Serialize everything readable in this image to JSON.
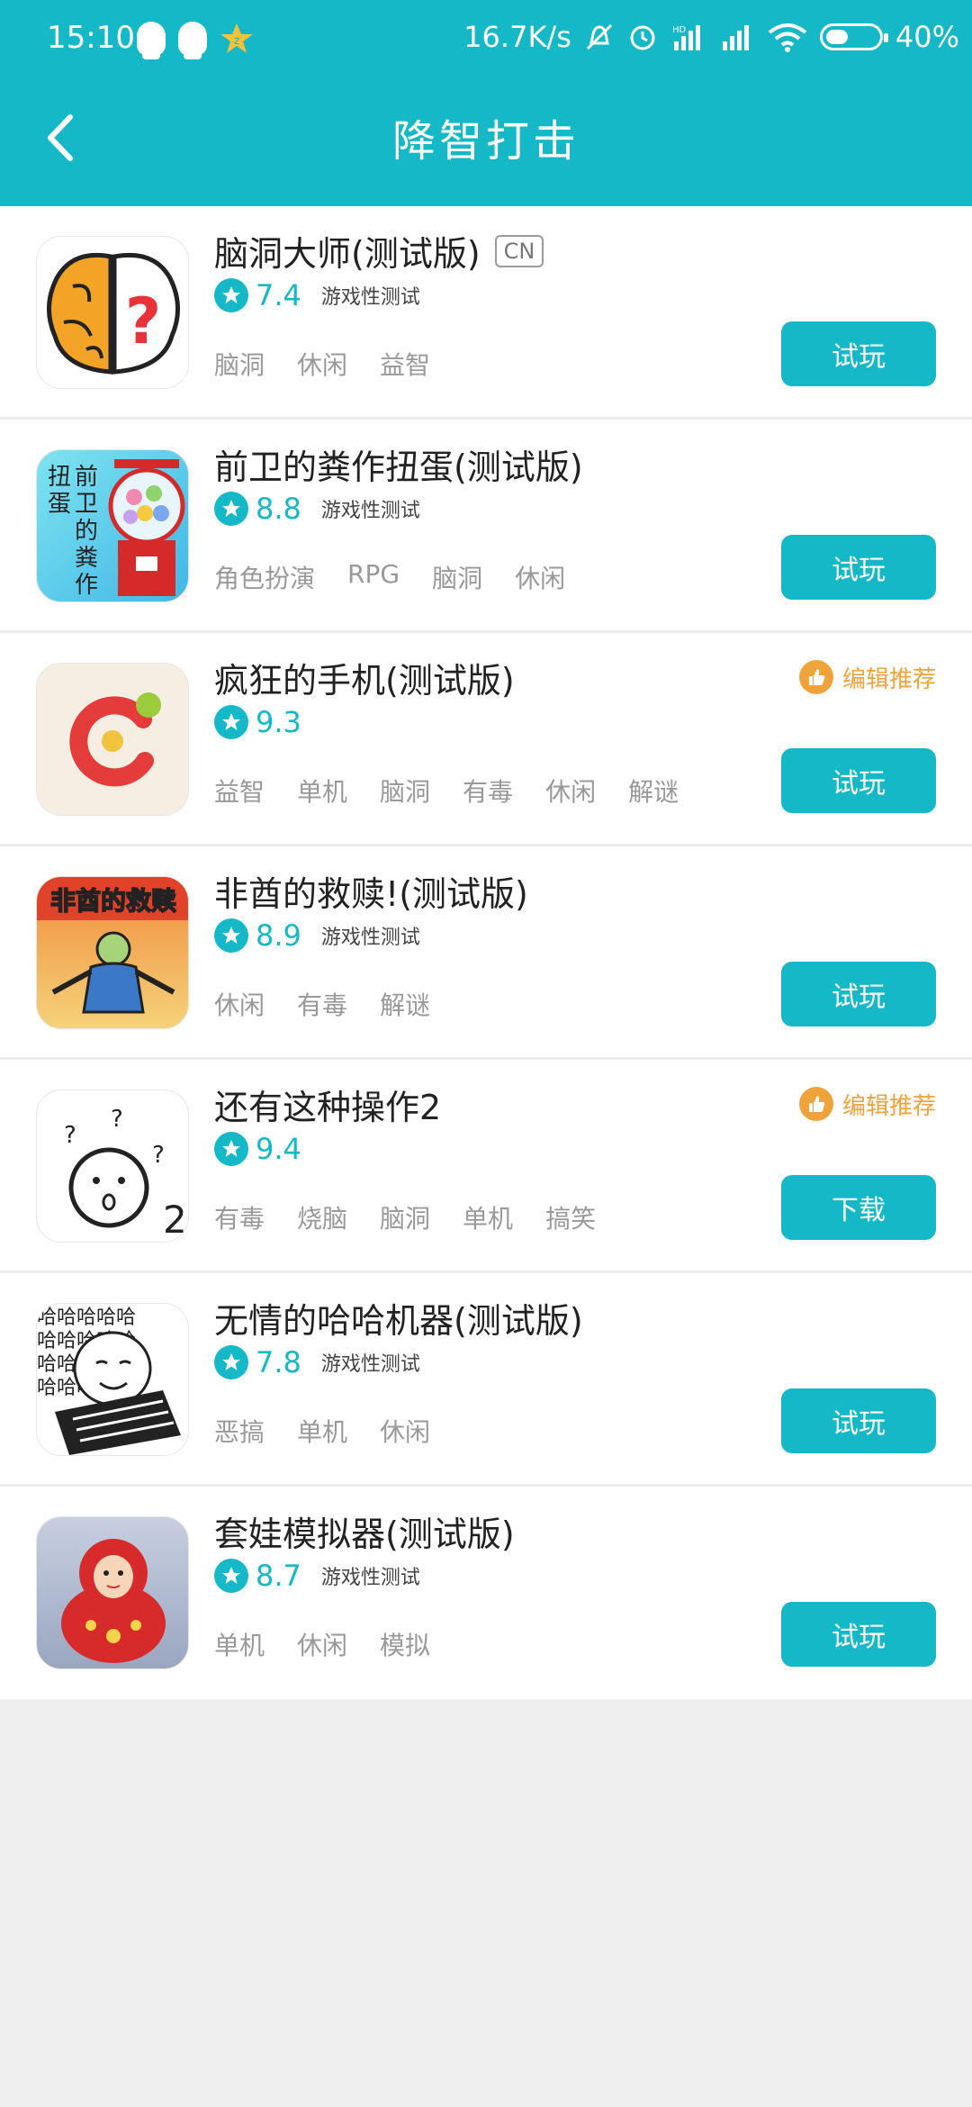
{
  "status_bar": {
    "time": "15:10",
    "network_speed": "16.7K/s",
    "battery": "40%",
    "icons": [
      "qq-icon",
      "qq-icon",
      "star-badge-icon",
      "mute-icon",
      "alarm-icon",
      "hd-signal-icon",
      "signal-icon",
      "wifi-icon",
      "battery-icon"
    ]
  },
  "header": {
    "title": "降智打击",
    "back_icon": "chevron-left-icon"
  },
  "colors": {
    "brand": "#15b8c7",
    "recommend": "#f0a33a",
    "tag_text": "#999999"
  },
  "games": [
    {
      "name": "脑洞大师(测试版)",
      "badge": "CN",
      "score": "7.4",
      "status": "游戏性测试",
      "tags": [
        "脑洞",
        "休闲",
        "益智"
      ],
      "button": "试玩",
      "recommend": "",
      "icon": "brain-question-icon"
    },
    {
      "name": "前卫的粪作扭蛋(测试版)",
      "badge": "",
      "score": "8.8",
      "status": "游戏性测试",
      "tags": [
        "角色扮演",
        "RPG",
        "脑洞",
        "休闲"
      ],
      "button": "试玩",
      "recommend": "",
      "icon": "gashapon-machine-icon",
      "icon_text_a": "前卫的粪作",
      "icon_text_b": "扭蛋"
    },
    {
      "name": "疯狂的手机(测试版)",
      "badge": "",
      "score": "9.3",
      "status": "",
      "tags": [
        "益智",
        "单机",
        "脑洞",
        "有毒",
        "休闲",
        "解谜"
      ],
      "button": "试玩",
      "recommend": "编辑推荐",
      "icon": "crazy-phone-logo-icon"
    },
    {
      "name": "非酋的救赎!(测试版)",
      "badge": "",
      "score": "8.9",
      "status": "游戏性测试",
      "tags": [
        "休闲",
        "有毒",
        "解谜"
      ],
      "button": "试玩",
      "recommend": "",
      "icon": "redemption-comic-icon",
      "icon_text": "非酋的救赎"
    },
    {
      "name": "还有这种操作2",
      "badge": "",
      "score": "9.4",
      "status": "",
      "tags": [
        "有毒",
        "烧脑",
        "脑洞",
        "单机",
        "搞笑"
      ],
      "button": "下载",
      "recommend": "编辑推荐",
      "icon": "surprised-face-icon",
      "icon_text": "2"
    },
    {
      "name": "无情的哈哈机器(测试版)",
      "badge": "",
      "score": "7.8",
      "status": "游戏性测试",
      "tags": [
        "恶搞",
        "单机",
        "休闲"
      ],
      "button": "试玩",
      "recommend": "",
      "icon": "haha-meme-keyboard-icon",
      "icon_text": "哈哈哈哈哈"
    },
    {
      "name": "套娃模拟器(测试版)",
      "badge": "",
      "score": "8.7",
      "status": "游戏性测试",
      "tags": [
        "单机",
        "休闲",
        "模拟"
      ],
      "button": "试玩",
      "recommend": "",
      "icon": "matryoshka-doll-icon"
    }
  ]
}
